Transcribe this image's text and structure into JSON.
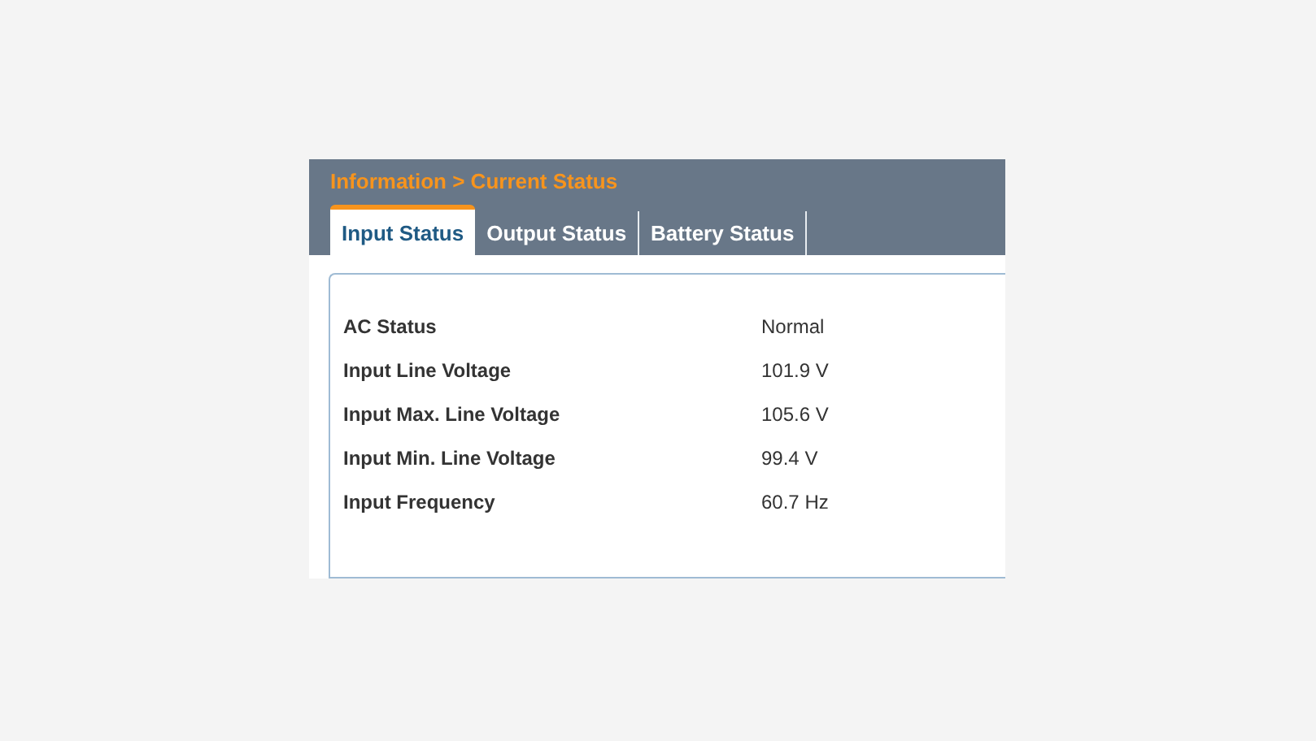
{
  "breadcrumb": "Information > Current Status",
  "tabs": [
    {
      "label": "Input Status",
      "selected": true
    },
    {
      "label": "Output Status",
      "selected": false
    },
    {
      "label": "Battery Status",
      "selected": false
    }
  ],
  "rows": [
    {
      "label": "AC Status",
      "value": "Normal"
    },
    {
      "label": "Input Line Voltage",
      "value": "101.9 V"
    },
    {
      "label": "Input Max. Line Voltage",
      "value": "105.6 V"
    },
    {
      "label": "Input Min. Line Voltage",
      "value": "99.4 V"
    },
    {
      "label": "Input Frequency",
      "value": "60.7 Hz"
    }
  ]
}
